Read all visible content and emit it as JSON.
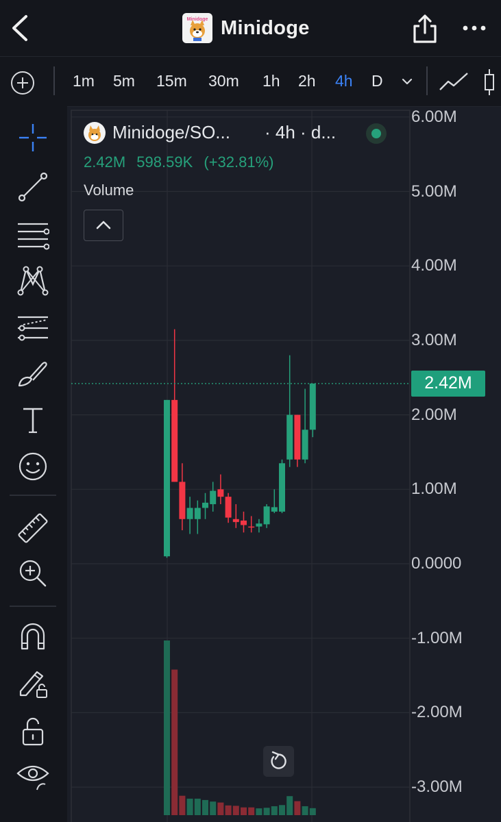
{
  "header": {
    "title": "Minidoge",
    "logo_text": "Minidoge",
    "icons": [
      "back-icon",
      "share-icon",
      "more-icon"
    ]
  },
  "toolbar": {
    "intervals": [
      {
        "label": "1m",
        "active": false
      },
      {
        "label": "5m",
        "active": false
      },
      {
        "label": "15m",
        "active": false
      },
      {
        "label": "30m",
        "active": false
      },
      {
        "label": "1h",
        "active": false
      },
      {
        "label": "2h",
        "active": false
      },
      {
        "label": "4h",
        "active": true
      },
      {
        "label": "D",
        "active": false
      }
    ],
    "icons": [
      "add-icon",
      "chevron-down-icon",
      "line-chart-icon",
      "candles-icon"
    ]
  },
  "sidebar": {
    "tools": [
      "crosshair-icon",
      "trend-line-icon",
      "horizontal-lines-icon",
      "pattern-icon",
      "fib-retracement-icon",
      "brush-icon",
      "text-icon",
      "emoji-icon",
      "ruler-icon",
      "zoom-in-icon",
      "magnet-icon",
      "lock-drawing-icon",
      "lock-icon",
      "eye-icon"
    ]
  },
  "legend": {
    "symbol": "Minidoge/SO...",
    "timeframe": "· 4h · d...",
    "price": "2.42M",
    "change": "598.59K",
    "change_pct": "(+32.81%)",
    "volume_label": "Volume"
  },
  "colors": {
    "up": "#26a17b",
    "down": "#f23645",
    "background": "#1b1e27",
    "grid": "#2a2d35"
  },
  "chart_data": {
    "type": "candlestick",
    "ylim": [
      -3.3,
      6.2
    ],
    "y_ticks": [
      "6.00M",
      "5.00M",
      "4.00M",
      "3.00M",
      "2.00M",
      "1.00M",
      "0.0000",
      "-1.00M",
      "-2.00M",
      "-3.00M"
    ],
    "y_tick_values": [
      6,
      5,
      4,
      3,
      2,
      1,
      0,
      -1,
      -2,
      -3
    ],
    "last_price": 2.42,
    "last_price_label": "2.42M",
    "candles": [
      {
        "o": 0.1,
        "h": 2.2,
        "l": 0.08,
        "c": 2.2
      },
      {
        "o": 2.2,
        "h": 3.15,
        "l": 1.1,
        "c": 1.1
      },
      {
        "o": 1.1,
        "h": 1.35,
        "l": 0.45,
        "c": 0.6
      },
      {
        "o": 0.6,
        "h": 0.9,
        "l": 0.4,
        "c": 0.75
      },
      {
        "o": 0.6,
        "h": 0.85,
        "l": 0.4,
        "c": 0.75
      },
      {
        "o": 0.75,
        "h": 0.95,
        "l": 0.6,
        "c": 0.82
      },
      {
        "o": 0.8,
        "h": 1.1,
        "l": 0.7,
        "c": 0.98
      },
      {
        "o": 1.0,
        "h": 1.2,
        "l": 0.8,
        "c": 0.9
      },
      {
        "o": 0.9,
        "h": 0.95,
        "l": 0.55,
        "c": 0.62
      },
      {
        "o": 0.6,
        "h": 0.8,
        "l": 0.48,
        "c": 0.56
      },
      {
        "o": 0.58,
        "h": 0.7,
        "l": 0.42,
        "c": 0.52
      },
      {
        "o": 0.5,
        "h": 0.64,
        "l": 0.42,
        "c": 0.49
      },
      {
        "o": 0.5,
        "h": 0.6,
        "l": 0.42,
        "c": 0.54
      },
      {
        "o": 0.53,
        "h": 0.8,
        "l": 0.48,
        "c": 0.77
      },
      {
        "o": 0.7,
        "h": 1.0,
        "l": 0.68,
        "c": 0.76
      },
      {
        "o": 0.7,
        "h": 1.4,
        "l": 0.68,
        "c": 1.35
      },
      {
        "o": 1.4,
        "h": 2.8,
        "l": 1.3,
        "c": 2.0
      },
      {
        "o": 2.0,
        "h": 2.0,
        "l": 1.3,
        "c": 1.4
      },
      {
        "o": 1.4,
        "h": 2.35,
        "l": 1.35,
        "c": 1.8
      },
      {
        "o": 1.8,
        "h": 2.42,
        "l": 1.7,
        "c": 2.42
      }
    ],
    "volume": [
      0.9,
      0.75,
      0.1,
      0.085,
      0.085,
      0.078,
      0.07,
      0.065,
      0.05,
      0.048,
      0.04,
      0.04,
      0.035,
      0.038,
      0.046,
      0.052,
      0.098,
      0.072,
      0.046,
      0.036
    ]
  }
}
